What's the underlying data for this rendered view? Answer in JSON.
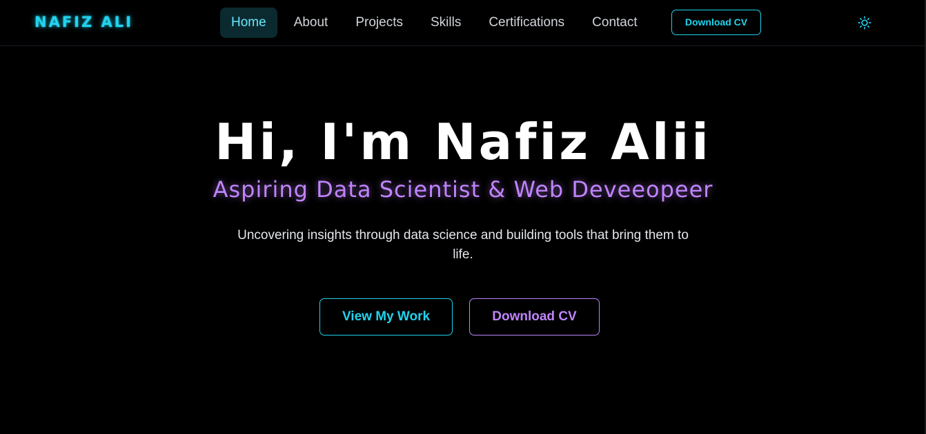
{
  "brand": {
    "logo_text": "NAFIZ ALI"
  },
  "nav": {
    "items": [
      {
        "label": "Home",
        "active": true
      },
      {
        "label": "About",
        "active": false
      },
      {
        "label": "Projects",
        "active": false
      },
      {
        "label": "Skills",
        "active": false
      },
      {
        "label": "Certifications",
        "active": false
      },
      {
        "label": "Contact",
        "active": false
      }
    ],
    "cv_button": "Download CV",
    "theme_icon": "sun-icon"
  },
  "hero": {
    "title": "Hi, I'm Nafiz Alii",
    "subtitle": "Aspiring Data Scientist & Web Deveeopeer",
    "description": "Uncovering insights through data science and building tools that bring them to life.",
    "primary_button": "View My Work",
    "secondary_button": "Download CV"
  },
  "colors": {
    "background": "#000000",
    "accent_cyan": "#22d3ee",
    "accent_purple": "#c084fc",
    "active_nav_bg": "#0b2a30",
    "text_primary": "#ffffff",
    "text_muted": "#d1d5db"
  }
}
